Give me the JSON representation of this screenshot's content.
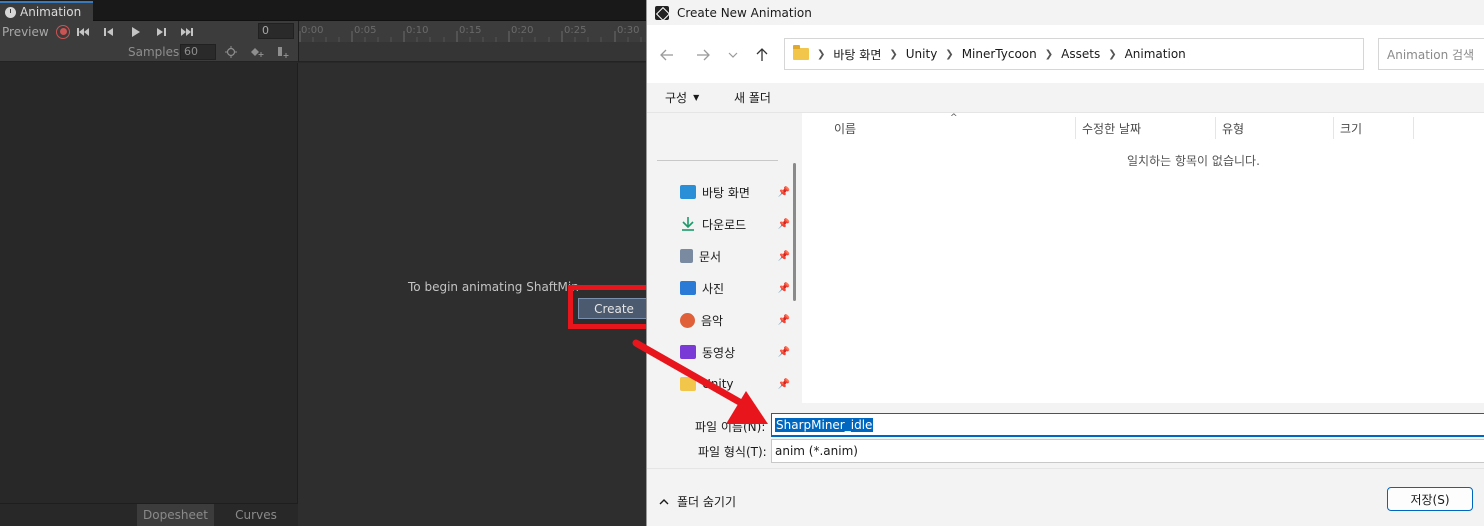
{
  "unity": {
    "tab_title": "Animation",
    "preview_label": "Preview",
    "frame_value": "0",
    "samples_label": "Samples",
    "samples_value": "60",
    "timeline_ticks": [
      "0:00",
      "0:05",
      "0:10",
      "0:15",
      "0:20",
      "0:25",
      "0:30"
    ],
    "begin_text": "To begin animating ShaftMin",
    "create_label": "Create",
    "bottom_tabs": [
      "Dopesheet",
      "Curves"
    ],
    "annotation_color": "#e8161c"
  },
  "dialog": {
    "title": "Create New Animation",
    "breadcrumbs": [
      "바탕 화면",
      "Unity",
      "MinerTycoon",
      "Assets",
      "Animation"
    ],
    "search_placeholder": "Animation 검색",
    "commands": {
      "organize": "구성",
      "new_folder": "새 폴더"
    },
    "sidebar": [
      {
        "label": "바탕 화면",
        "icon": "desktop-icon",
        "color": "#2a8fd6"
      },
      {
        "label": "다운로드",
        "icon": "download-icon",
        "color": "#1a9a6a"
      },
      {
        "label": "문서",
        "icon": "document-icon",
        "color": "#7a8aa0"
      },
      {
        "label": "사진",
        "icon": "pictures-icon",
        "color": "#2a7ad6"
      },
      {
        "label": "음악",
        "icon": "music-icon",
        "color": "#e0603a"
      },
      {
        "label": "동영상",
        "icon": "video-icon",
        "color": "#7a3ad6"
      },
      {
        "label": "Unity",
        "icon": "folder-icon",
        "color": "#f2c54b"
      }
    ],
    "columns": [
      "이름",
      "수정한 날짜",
      "유형",
      "크기"
    ],
    "empty_message": "일치하는 항목이 없습니다.",
    "filename_label": "파일 이름(N):",
    "filename_value": "SharpMiner_idle",
    "filetype_label": "파일 형식(T):",
    "filetype_value": "anim (*.anim)",
    "hide_folders_label": "폴더 숨기기",
    "save_label": "저장(S)",
    "accent": "#0067c0"
  }
}
